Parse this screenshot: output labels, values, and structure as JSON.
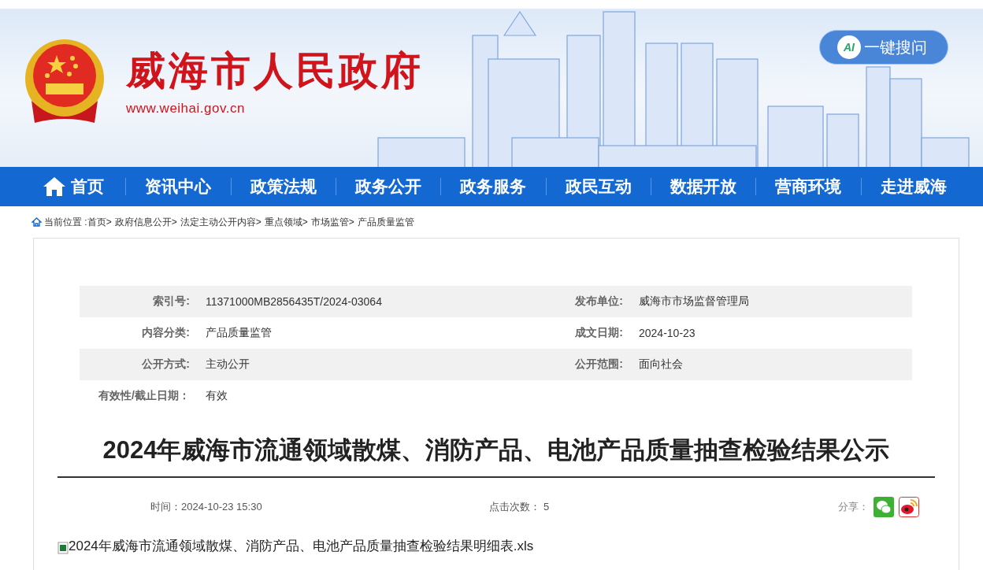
{
  "header": {
    "title": "威海市人民政府",
    "url": "www.weihai.gov.cn",
    "ai_search": {
      "badge": "AI",
      "label": "一键搜问"
    }
  },
  "nav": [
    {
      "label": "首页",
      "kind": "home"
    },
    {
      "label": "资讯中心",
      "kind": "plain"
    },
    {
      "label": "政策法规",
      "kind": "plain"
    },
    {
      "label": "政务公开",
      "kind": "plain"
    },
    {
      "label": "政务服务",
      "kind": "plain"
    },
    {
      "label": "政民互动",
      "kind": "plain"
    },
    {
      "label": "数据开放",
      "kind": "plain"
    },
    {
      "label": "营商环境",
      "kind": "plain"
    },
    {
      "label": "走进威海",
      "kind": "plain"
    }
  ],
  "breadcrumb": {
    "label": "当前位置 :",
    "separator": ">",
    "items": [
      "首页",
      "政府信息公开",
      "法定主动公开内容",
      "重点领域",
      "市场监管",
      "产品质量监管"
    ]
  },
  "meta_rows": [
    [
      {
        "label": "索引号:",
        "value": "11371000MB2856435T/2024-03064"
      },
      {
        "label": "发布单位:",
        "value": "威海市市场监督管理局"
      }
    ],
    [
      {
        "label": "内容分类:",
        "value": "产品质量监管"
      },
      {
        "label": "成文日期:",
        "value": "2024-10-23"
      }
    ],
    [
      {
        "label": "公开方式:",
        "value": "主动公开"
      },
      {
        "label": "公开范围:",
        "value": "面向社会"
      }
    ],
    [
      {
        "label": "有效性/截止日期：",
        "value": "有效"
      }
    ]
  ],
  "article": {
    "title": "2024年威海市流通领域散煤、消防产品、电池产品质量抽查检验结果公示",
    "time": "时间：2024-10-23 15:30",
    "clicks_label": "点击次数：",
    "clicks": "5",
    "share_label": "分享：",
    "attachment": "2024年威海市流通领域散煤、消防产品、电池产品质量抽查检验结果明细表.xls"
  }
}
